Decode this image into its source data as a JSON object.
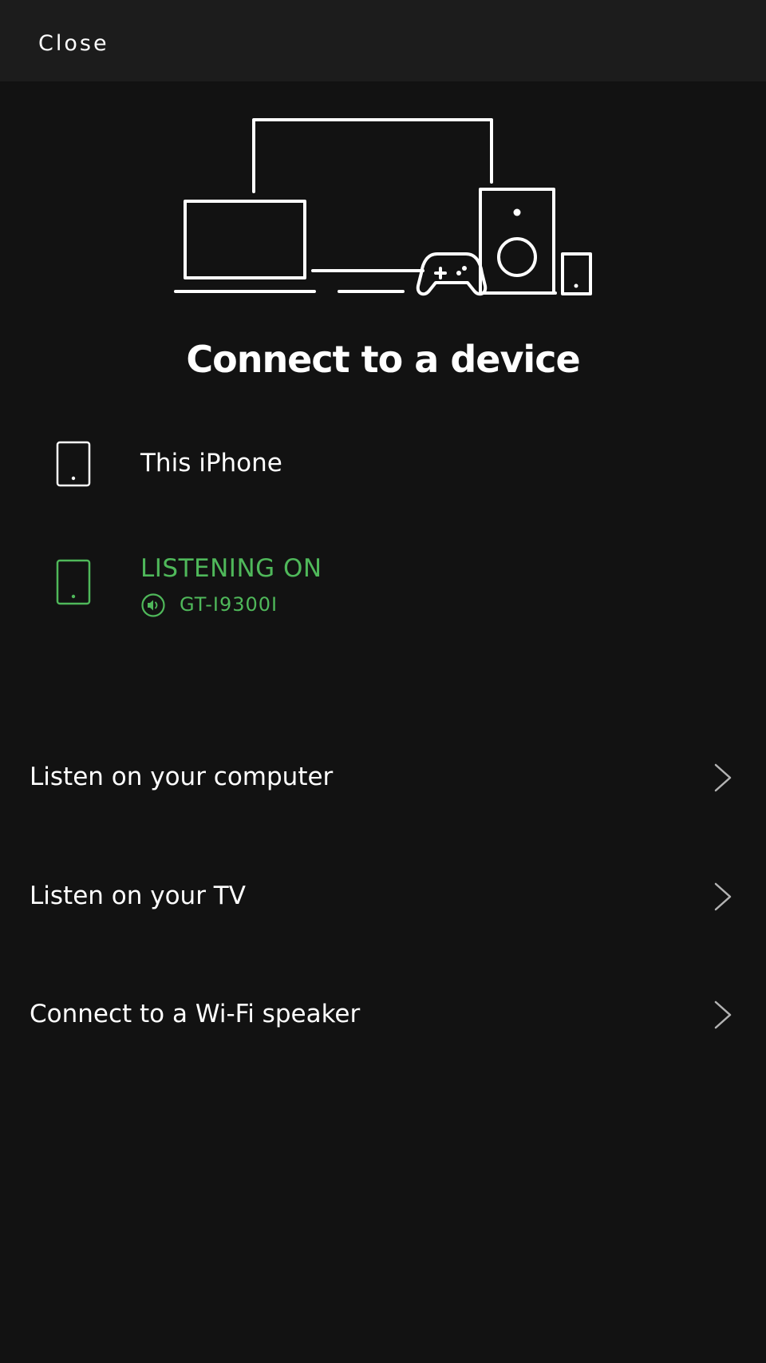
{
  "header": {
    "close_label": "Close"
  },
  "main": {
    "title": "Connect to a device",
    "hero_icon": "devices-illustration",
    "devices": [
      {
        "name": "This iPhone",
        "icon": "phone-icon"
      }
    ],
    "active_device": {
      "status": "LISTENING ON",
      "name": "GT-I9300I",
      "icon": "phone-icon",
      "status_icon": "speaker-icon"
    },
    "options": [
      {
        "label": "Listen on your computer",
        "icon": "chevron-right-icon"
      },
      {
        "label": "Listen on your TV",
        "icon": "chevron-right-icon"
      },
      {
        "label": "Connect to a Wi-Fi speaker",
        "icon": "chevron-right-icon"
      }
    ]
  },
  "colors": {
    "background": "#121212",
    "header_background": "#1c1c1c",
    "accent_green": "#4fb85a",
    "text": "#ffffff",
    "chevron": "#b3b3b3"
  }
}
